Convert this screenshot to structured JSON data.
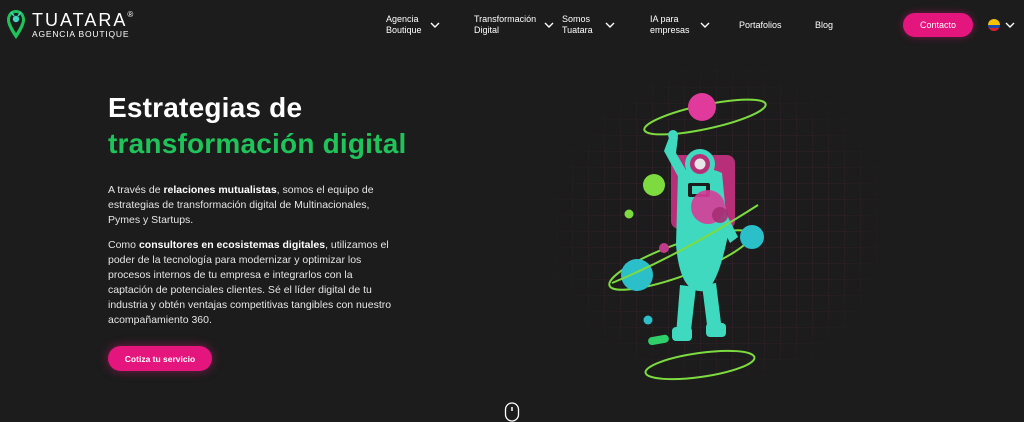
{
  "header": {
    "logo": {
      "name": "TUATARA",
      "trademark": "®",
      "subtitle": "AGENCIA BOUTIQUE"
    },
    "nav": [
      {
        "label": "Agencia\nBoutique",
        "has_dropdown": true
      },
      {
        "label": "Transformación\nDigital",
        "has_dropdown": true
      },
      {
        "label": "Somos\nTuatara",
        "has_dropdown": true
      },
      {
        "label": "IA para\nempresas",
        "has_dropdown": true
      },
      {
        "label": "Portafolios",
        "has_dropdown": false
      },
      {
        "label": "Blog",
        "has_dropdown": false
      }
    ],
    "contact_label": "Contacto",
    "language_icon": "colombia-flag-icon"
  },
  "hero": {
    "title_line1": "Estrategias de",
    "title_line2": "transformación digital",
    "para1": {
      "pre": "A través de ",
      "bold": "relaciones mutualistas",
      "post": ", somos el equipo de estrategias de transformación digital de Multinacionales, Pymes y Startups."
    },
    "para2": {
      "pre": "Como ",
      "bold": "consultores en ecosistemas digitales",
      "post": ", utilizamos el poder de la tecnología para modernizar y optimizar los procesos internos de tu empresa e integrarlos con la captación de potenciales clientes. Sé el líder digital de tu industria y obtén ventajas competitivas tangibles con nuestro acompañamiento 360."
    },
    "cta_label": "Cotiza tu servicio"
  },
  "colors": {
    "background": "#1c1c1c",
    "accent_pink": "#e4157d",
    "accent_green": "#1fc35a",
    "astronaut_teal": "#3fd9c0"
  },
  "icons": {
    "scroll": "mouse-scroll-icon",
    "chevron": "chevron-down-icon",
    "logo": "location-pin-logo-icon"
  }
}
